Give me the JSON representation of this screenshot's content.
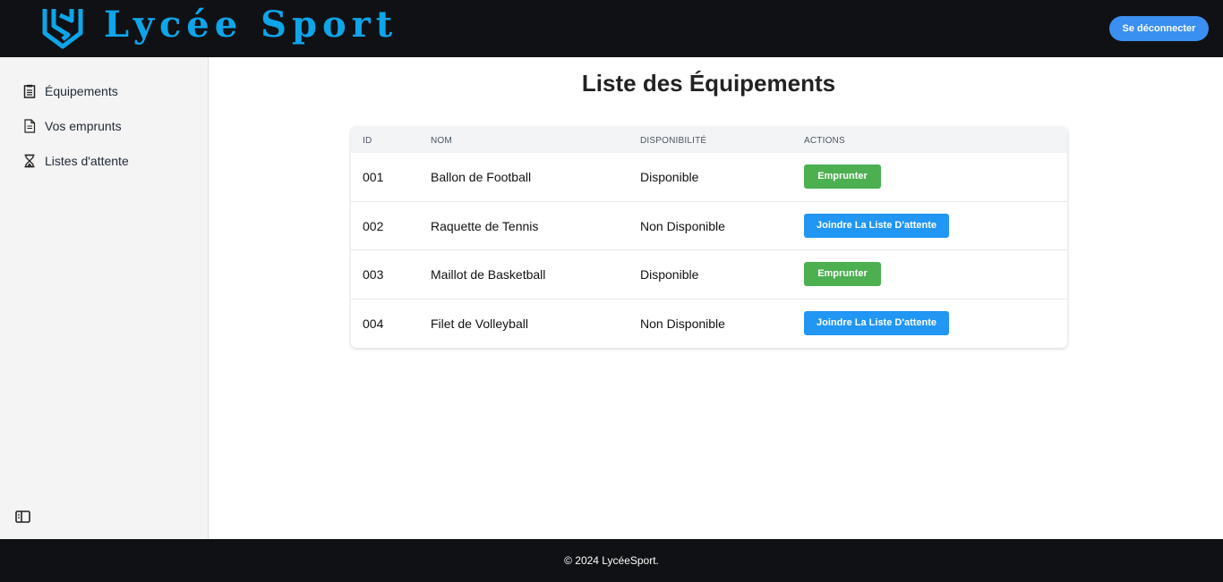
{
  "header": {
    "brand": "Lycée Sport",
    "logout_label": "Se déconnecter"
  },
  "sidebar": {
    "items": [
      {
        "label": "Équipements",
        "icon": "clipboard-icon"
      },
      {
        "label": "Vos emprunts",
        "icon": "document-icon"
      },
      {
        "label": "Listes d'attente",
        "icon": "hourglass-icon"
      }
    ],
    "collapse_icon": "sidebar-toggle-icon"
  },
  "main": {
    "title": "Liste des Équipements",
    "table": {
      "headers": [
        "ID",
        "NOM",
        "DISPONIBILITÉ",
        "ACTIONS"
      ],
      "rows": [
        {
          "id": "001",
          "name": "Ballon de Football",
          "status": "Disponible",
          "action": "Emprunter"
        },
        {
          "id": "002",
          "name": "Raquette de Tennis",
          "status": "Non Disponible",
          "action": "Joindre La Liste D'attente"
        },
        {
          "id": "003",
          "name": "Maillot de Basketball",
          "status": "Disponible",
          "action": "Emprunter"
        },
        {
          "id": "004",
          "name": "Filet de Volleyball",
          "status": "Non Disponible",
          "action": "Joindre La Liste D'attente"
        }
      ]
    }
  },
  "footer": {
    "text": "© 2024 LycéeSport."
  },
  "colors": {
    "brand": "#0ea5e9",
    "logout": "#3b8ff0",
    "borrow": "#4caf50",
    "waitlist": "#2196f3",
    "header_bg": "#101114"
  }
}
